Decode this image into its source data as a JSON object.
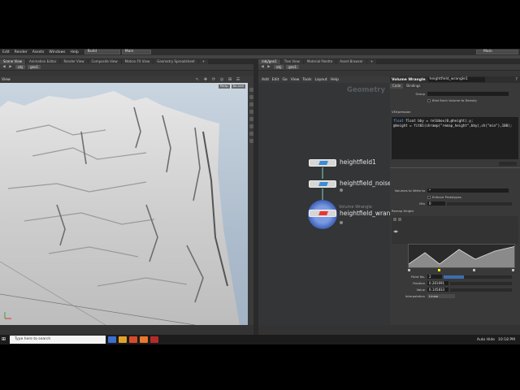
{
  "menus": [
    "Edit",
    "Render",
    "Assets",
    "Windows",
    "Help"
  ],
  "desktop_selector": "Build",
  "main_selector": "Main",
  "main_right_selector": "Main",
  "left_tabs": [
    "Scene View",
    "Animation Editor",
    "Render View",
    "Composite View",
    "Motion FX View",
    "Geometry Spreadsheet"
  ],
  "left_path": [
    "obj",
    "geo1"
  ],
  "viewport": {
    "label": "View",
    "persp": "Persp",
    "cam": "No cam"
  },
  "right_tabs": [
    "/obj/geo1",
    "Tree View",
    "Material Palette",
    "Asset Browser"
  ],
  "right_path": [
    "obj",
    "geo1"
  ],
  "network_menu": [
    "Add",
    "Edit",
    "Go",
    "View",
    "Tools",
    "Layout",
    "Help"
  ],
  "network_title": "Geometry",
  "nodes": [
    {
      "name": "heightfield1"
    },
    {
      "name": "heightfield_noise1"
    },
    {
      "name": "heightfield_wrangle1",
      "type": "Volume Wrangle"
    }
  ],
  "params": {
    "node_type": "Volume Wrangle",
    "node_name": "heightfield_wrangle1",
    "tabs": [
      "Code",
      "Bindings"
    ],
    "group_label": "Group",
    "bind_check_label": "Bind Each Volume to Density",
    "vex_label": "VEXpression",
    "code_lines": [
      "float bby = relbbox(0,@height).y;",
      "@height = fit01(chramp(\"remap_height\",bby),ch(\"min\"),100);"
    ],
    "volumes_label": "Volumes to Write to",
    "volumes_value": "*",
    "enforce_label": "Enforce Prototypes",
    "min_label": "Min",
    "min_value": "0",
    "ramp_label": "Remap Height",
    "point_no_label": "Point No.",
    "point_no_value": "2",
    "position_label": "Position",
    "position_value": "0.281691",
    "value_label": "Value",
    "value_value": "0.145833",
    "interp_label": "Interpolation",
    "interp_value": "Linear"
  },
  "taskbar": {
    "search_placeholder": "Type here to search",
    "auto_hide": "Auto Hide",
    "clock": "10:18 PM"
  }
}
